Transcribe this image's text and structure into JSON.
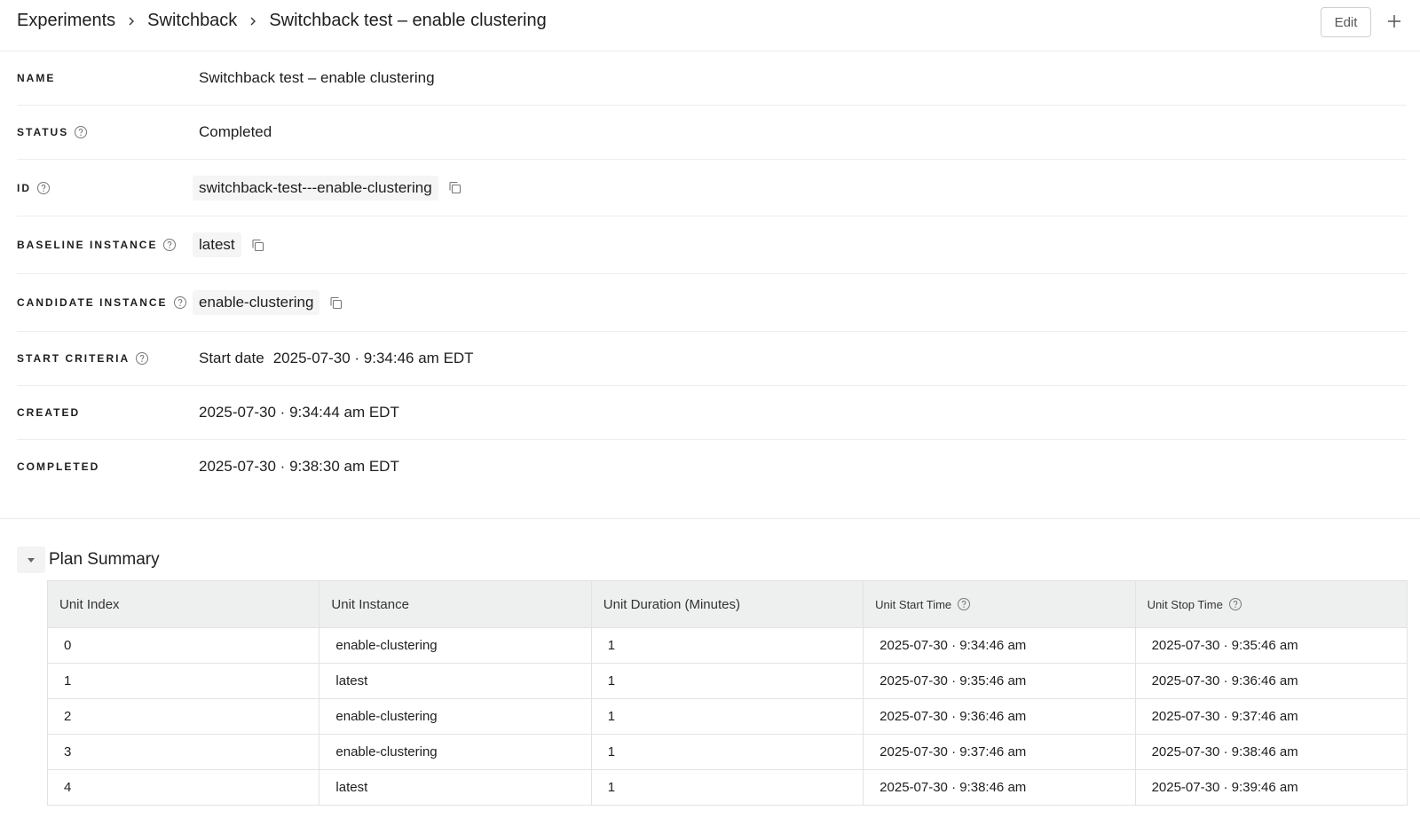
{
  "breadcrumb": {
    "items": [
      "Experiments",
      "Switchback"
    ],
    "current": "Switchback test – enable clustering"
  },
  "toolbar": {
    "edit_label": "Edit",
    "add_icon": "plus-icon"
  },
  "details": {
    "name": {
      "label": "NAME",
      "value": "Switchback test – enable clustering"
    },
    "status": {
      "label": "STATUS",
      "value": "Completed"
    },
    "id": {
      "label": "ID",
      "value": "switchback-test---enable-clustering"
    },
    "baseline": {
      "label": "BASELINE INSTANCE",
      "value": "latest"
    },
    "candidate": {
      "label": "CANDIDATE INSTANCE",
      "value": "enable-clustering"
    },
    "start": {
      "label": "START CRITERIA",
      "prefix": "Start date",
      "value": "2025-07-30 · 9:34:46 am EDT"
    },
    "created": {
      "label": "CREATED",
      "value": "2025-07-30 · 9:34:44 am EDT"
    },
    "completed": {
      "label": "COMPLETED",
      "value": "2025-07-30 · 9:38:30 am EDT"
    }
  },
  "plan": {
    "title": "Plan Summary",
    "headers": [
      "Unit Index",
      "Unit Instance",
      "Unit Duration (Minutes)",
      "Unit Start Time",
      "Unit Stop Time"
    ],
    "rows": [
      [
        "0",
        "enable-clustering",
        "1",
        "2025-07-30 · 9:34:46 am",
        "2025-07-30 · 9:35:46 am"
      ],
      [
        "1",
        "latest",
        "1",
        "2025-07-30 · 9:35:46 am",
        "2025-07-30 · 9:36:46 am"
      ],
      [
        "2",
        "enable-clustering",
        "1",
        "2025-07-30 · 9:36:46 am",
        "2025-07-30 · 9:37:46 am"
      ],
      [
        "3",
        "enable-clustering",
        "1",
        "2025-07-30 · 9:37:46 am",
        "2025-07-30 · 9:38:46 am"
      ],
      [
        "4",
        "latest",
        "1",
        "2025-07-30 · 9:38:46 am",
        "2025-07-30 · 9:39:46 am"
      ]
    ]
  }
}
